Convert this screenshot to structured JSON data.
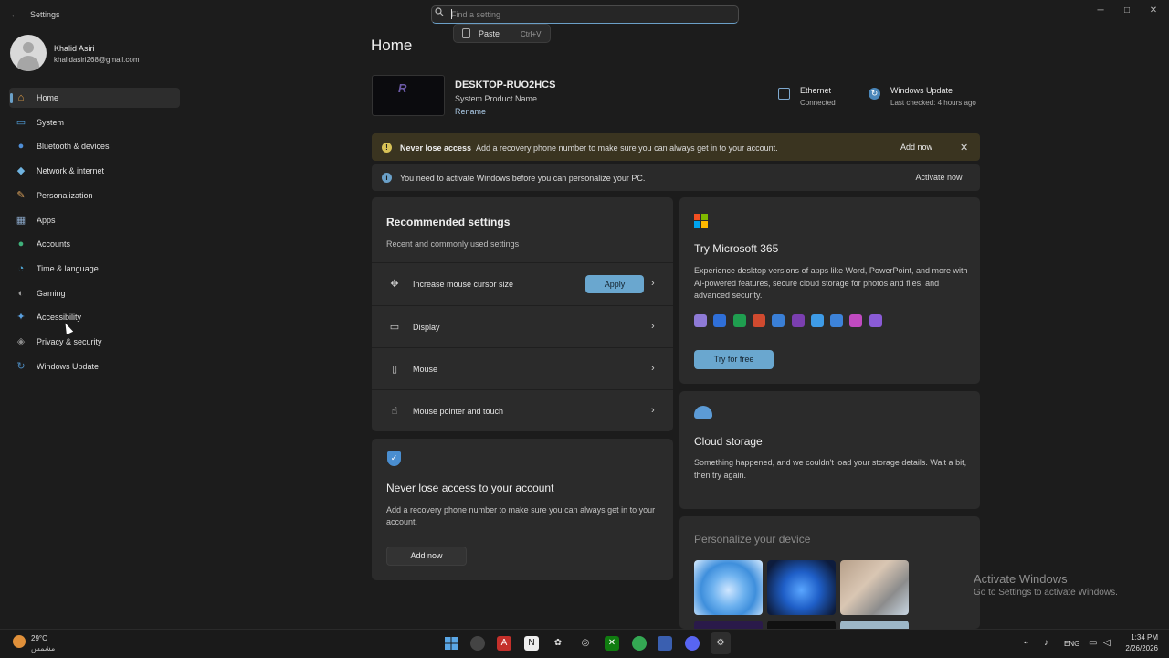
{
  "window": {
    "title": "Settings",
    "back_icon": "←",
    "minimize_icon": "─",
    "maximize_icon": "□",
    "close_icon": "✕"
  },
  "search": {
    "placeholder": "Find a setting",
    "value": "",
    "context_menu": {
      "label": "Paste",
      "shortcut": "Ctrl+V"
    }
  },
  "profile": {
    "name": "Khalid Asiri",
    "email": "khalidasiri268@gmail.com"
  },
  "sidebar": {
    "items": [
      {
        "label": "Home",
        "icon": "⌂",
        "color": "#e8a449",
        "active": true
      },
      {
        "label": "System",
        "icon": "▭",
        "color": "#4f9bd6"
      },
      {
        "label": "Bluetooth & devices",
        "icon": "●",
        "color": "#4f8ed6"
      },
      {
        "label": "Network & internet",
        "icon": "◆",
        "color": "#6fb3e0"
      },
      {
        "label": "Personalization",
        "icon": "✎",
        "color": "#d9a05b"
      },
      {
        "label": "Apps",
        "icon": "▦",
        "color": "#8aa7c8"
      },
      {
        "label": "Accounts",
        "icon": "●",
        "color": "#3fb07a"
      },
      {
        "label": "Time & language",
        "icon": "◔",
        "color": "#4ea7d6"
      },
      {
        "label": "Gaming",
        "icon": "◐",
        "color": "#9a9a9a"
      },
      {
        "label": "Accessibility",
        "icon": "✦",
        "color": "#5aa0e0"
      },
      {
        "label": "Privacy & security",
        "icon": "◈",
        "color": "#8f8f8f"
      },
      {
        "label": "Windows Update",
        "icon": "↻",
        "color": "#4a86b9"
      }
    ]
  },
  "main": {
    "title": "Home",
    "device": {
      "name": "DESKTOP-RUO2HCS",
      "product": "System Product Name",
      "rename": "Rename"
    },
    "status": {
      "ethernet_title": "Ethernet",
      "ethernet_status": "Connected",
      "update_title": "Windows Update",
      "update_status": "Last checked: 4 hours ago"
    },
    "banner_account": {
      "title": "Never lose access",
      "text": "Add a recovery phone number to make sure you can always get in to your account.",
      "button": "Add now",
      "close": "✕"
    },
    "banner_activate": {
      "text": "You need to activate Windows before you can personalize your PC.",
      "button": "Activate now"
    },
    "recommended": {
      "title": "Recommended settings",
      "subtitle": "Recent and commonly used settings",
      "rows": [
        {
          "label": "Increase mouse cursor size",
          "icon": "✥",
          "button": "Apply"
        },
        {
          "label": "Display",
          "icon": "▭"
        },
        {
          "label": "Mouse",
          "icon": "▯"
        },
        {
          "label": "Mouse pointer and touch",
          "icon": "☝"
        }
      ],
      "chevron": "›"
    },
    "never_lose": {
      "title": "Never lose access to your account",
      "text": "Add a recovery phone number to make sure you can always get in to your account.",
      "button": "Add now",
      "icon": "✓"
    },
    "m365": {
      "title": "Try Microsoft 365",
      "text": "Experience desktop versions of apps like Word, PowerPoint, and more with AI-powered features, secure cloud storage for photos and files, and advanced security.",
      "button": "Try for free",
      "app_colors": [
        "#8e7ad6",
        "#2f6fd8",
        "#1f9e4f",
        "#d04a2f",
        "#3a7fd6",
        "#7b3fb0",
        "#3e9be6",
        "#3d83d9",
        "#c04ac0",
        "#8a5bd6"
      ]
    },
    "cloud": {
      "title": "Cloud storage",
      "text": "Something happened, and we couldn't load your storage details. Wait a bit, then try again."
    },
    "personalize": {
      "title": "Personalize your device"
    },
    "watermark": {
      "title": "Activate Windows",
      "text": "Go to Settings to activate Windows."
    }
  },
  "taskbar": {
    "weather_temp": "29°C",
    "weather_cond": "مشمس",
    "language": "ENG",
    "time": "1:34 PM",
    "date": "2/26/2026"
  }
}
